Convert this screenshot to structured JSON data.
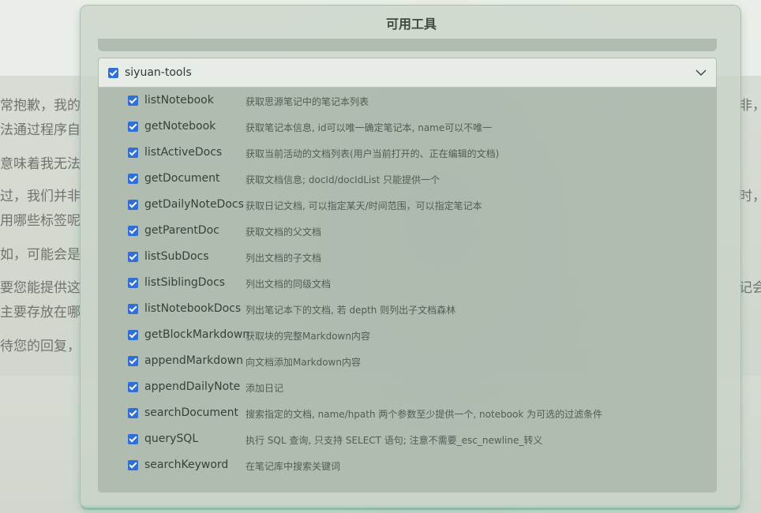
{
  "background": {
    "left_lines": [
      "常抱歉，我的",
      "法通过程序自",
      "意味着我无法",
      "过，我们并非",
      "用哪些标签呢",
      "如，可能会是",
      "要您能提供这",
      "主要存放在哪",
      "待您的回复，"
    ],
    "right_lines": [
      "非，",
      "时，",
      "记会"
    ]
  },
  "modal": {
    "title": "可用工具",
    "group": {
      "name": "siyuan-tools",
      "checked": true,
      "expand_icon": "chevron-down-icon",
      "tools": [
        {
          "name": "listNotebook",
          "desc": "获取思源笔记中的笔记本列表",
          "checked": true
        },
        {
          "name": "getNotebook",
          "desc": "获取笔记本信息, id可以唯一确定笔记本, name可以不唯一",
          "checked": true
        },
        {
          "name": "listActiveDocs",
          "desc": "获取当前活动的文档列表(用户当前打开的、正在编辑的文档)",
          "checked": true
        },
        {
          "name": "getDocument",
          "desc": "获取文档信息; docId/docIdList 只能提供一个",
          "checked": true
        },
        {
          "name": "getDailyNoteDocs",
          "desc": "获取日记文档, 可以指定某天/时间范围，可以指定笔记本",
          "checked": true
        },
        {
          "name": "getParentDoc",
          "desc": "获取文档的父文档",
          "checked": true
        },
        {
          "name": "listSubDocs",
          "desc": "列出文档的子文档",
          "checked": true
        },
        {
          "name": "listSiblingDocs",
          "desc": "列出文档的同级文档",
          "checked": true
        },
        {
          "name": "listNotebookDocs",
          "desc": "列出笔记本下的文档, 若 depth 则列出子文档森林",
          "checked": true
        },
        {
          "name": "getBlockMarkdown",
          "desc": "获取块的完整Markdown内容",
          "checked": true
        },
        {
          "name": "appendMarkdown",
          "desc": "向文档添加Markdown内容",
          "checked": true
        },
        {
          "name": "appendDailyNote",
          "desc": "添加日记",
          "checked": true
        },
        {
          "name": "searchDocument",
          "desc": "搜索指定的文档, name/hpath 两个参数至少提供一个, notebook 为可选的过滤条件",
          "checked": true
        },
        {
          "name": "querySQL",
          "desc": "执行 SQL 查询, 只支持 SELECT 语句; 注意不需要_esc_newline_转义",
          "checked": true
        },
        {
          "name": "searchKeyword",
          "desc": "在笔记库中搜索关键词",
          "checked": true
        }
      ]
    }
  },
  "colors": {
    "checkbox": "#2f6fd6",
    "accent": "#6eb9a5"
  }
}
